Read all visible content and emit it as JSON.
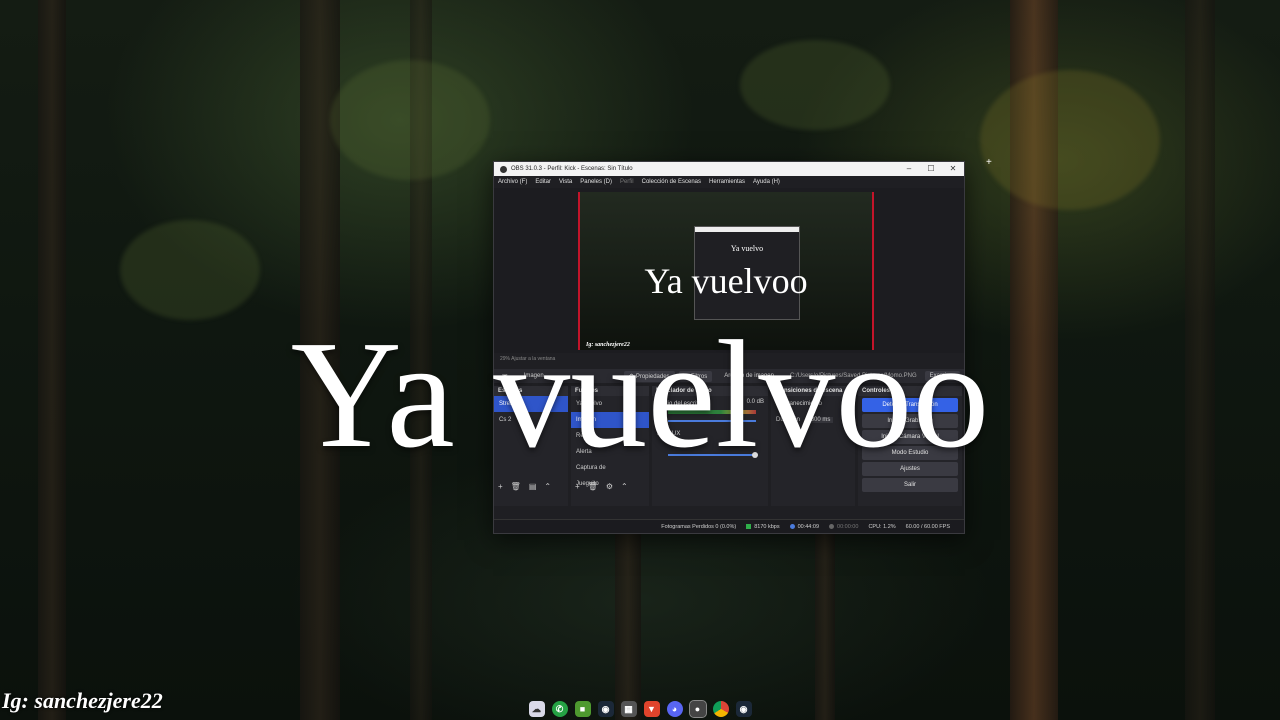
{
  "desktop": {
    "overlay_text": "Ya vuelvoo",
    "watermark": "Ig: sanchezjere22"
  },
  "obs": {
    "title": "OBS 31.0.3 - Perfil: Kick - Escenas: Sin Título",
    "menu": [
      "Archivo (F)",
      "Editar",
      "Vista",
      "Paneles (D)",
      "Perfil",
      "Colección de Escenas",
      "Herramientas",
      "Ayuda (H)"
    ],
    "preview_text": "Ya vuelvoo",
    "preview_ig": "Ig: sanchezjere22",
    "inner_text": "Ya vuelvo",
    "zoom_label": "29%   Ajustar a la ventana",
    "source_bar": {
      "selected": "Imagen",
      "properties": "Propiedades",
      "filters": "Filtros",
      "image_label": "Archivo de imagen",
      "image_path": "C:/Users/o/Pictures/Saved Pictures/Momo.PNG",
      "browse": "Examinar"
    },
    "scenes": {
      "header": "Escenas",
      "items": [
        "Stream",
        "Cs 2"
      ]
    },
    "sources": {
      "header": "Fuentes",
      "items": [
        "Ya vuelvo",
        "Imagen",
        "Recle",
        "Alerta",
        "Captura de",
        "Jueguito"
      ]
    },
    "mixer": {
      "header": "Mezclador de audio",
      "tracks": [
        "Audio del escritorio",
        "Mic/AUX"
      ],
      "level_db": "0.0 dB"
    },
    "transitions": {
      "header": "Transiciones de escena",
      "type": "Desvanecimiento",
      "duration_label": "Duración",
      "duration_value": "300 ms"
    },
    "controls": {
      "header": "Controles",
      "buttons": [
        "Detener Transmisión",
        "Iniciar Grabación",
        "Iniciar Cámara Virtual",
        "Modo Estudio",
        "Ajustes",
        "Salir"
      ]
    },
    "status": {
      "dropped": "Fotogramas Perdidos 0 (0.0%)",
      "bitrate": "8170 kbps",
      "stream_time": "00:44:09",
      "rec_time": "00:00:00",
      "cpu": "CPU: 1.2%",
      "fps": "60.00 / 60.00 FPS"
    }
  },
  "taskbar": {
    "icons": [
      "cloud-app-icon",
      "whatsapp-icon",
      "minecraft-icon",
      "steam-icon",
      "gallery-icon",
      "brave-icon",
      "discord-icon",
      "obs-icon",
      "chrome-icon",
      "steam-icon-2"
    ]
  }
}
